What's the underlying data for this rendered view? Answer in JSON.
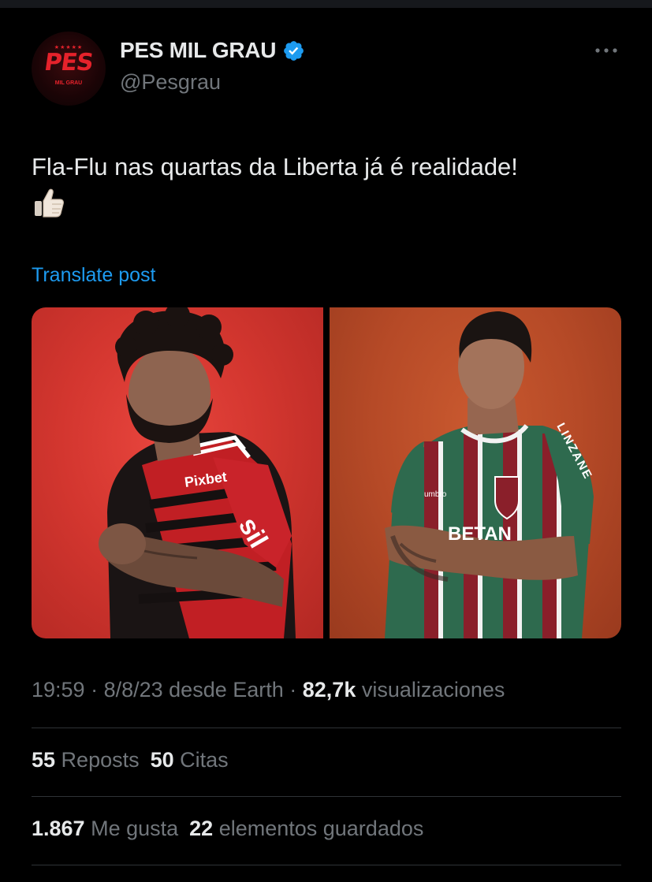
{
  "author": {
    "display_name": "PES MIL GRAU",
    "handle": "@Pesgrau",
    "avatar_text": "PES",
    "avatar_subtext": "MIL GRAU",
    "verified_icon": "verified-badge-icon"
  },
  "post": {
    "text": "Fla-Flu nas quartas da Liberta já é realidade!",
    "emoji_icon": "thumbs-up-icon",
    "translate_label": "Translate post"
  },
  "media": {
    "left_photo_icon": "photo-player-red-shirt",
    "right_photo_icon": "photo-player-tricolor-shirt",
    "left_shirt_text": "Pixbet",
    "left_sleeve_text": "sil",
    "right_shirt_text": "BETAN",
    "right_sleeve_text": "LINZANE",
    "right_brand_text": "umbro"
  },
  "meta": {
    "time": "19:59",
    "sep1": " · ",
    "date": "8/8/23",
    "source": " desde Earth",
    "sep2": " · ",
    "views_count": "82,7k",
    "views_label": " visualizaciones"
  },
  "stats_row1": {
    "reposts_count": "55",
    "reposts_label": " Reposts",
    "quotes_count": "50",
    "quotes_label": " Citas"
  },
  "stats_row2": {
    "likes_count": "1.867",
    "likes_label": " Me gusta",
    "bookmarks_count": "22",
    "bookmarks_label": " elementos guardados"
  },
  "colors": {
    "background": "#000000",
    "text": "#e7e9ea",
    "secondary": "#71767b",
    "link": "#1d9bf0",
    "divider": "#2f3336"
  }
}
